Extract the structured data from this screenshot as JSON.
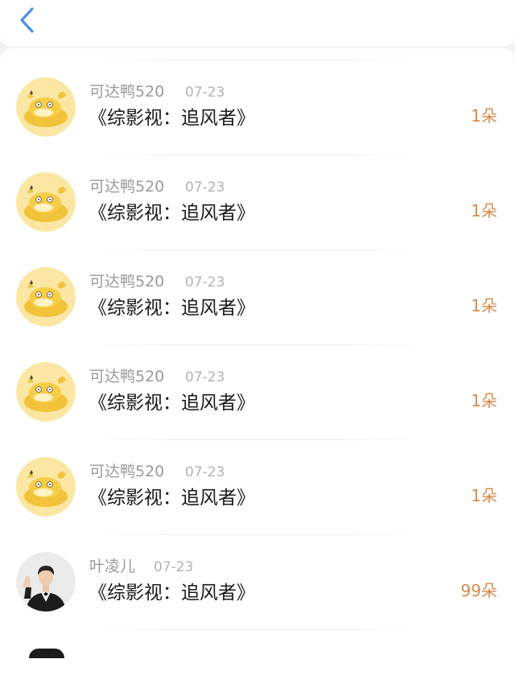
{
  "header": {
    "back_icon": "chevron-left-icon",
    "accent_color": "#4a90e2"
  },
  "gift_list": {
    "amount_color": "#d9894a",
    "items": [
      {
        "name": "可达鸭520",
        "date": "07-23",
        "title": "《综影视：追风者》",
        "amount": "1朵",
        "avatar_icon": "psyduck-avatar-icon"
      },
      {
        "name": "可达鸭520",
        "date": "07-23",
        "title": "《综影视：追风者》",
        "amount": "1朵",
        "avatar_icon": "psyduck-avatar-icon"
      },
      {
        "name": "可达鸭520",
        "date": "07-23",
        "title": "《综影视：追风者》",
        "amount": "1朵",
        "avatar_icon": "psyduck-avatar-icon"
      },
      {
        "name": "可达鸭520",
        "date": "07-23",
        "title": "《综影视：追风者》",
        "amount": "1朵",
        "avatar_icon": "psyduck-avatar-icon"
      },
      {
        "name": "可达鸭520",
        "date": "07-23",
        "title": "《综影视：追风者》",
        "amount": "1朵",
        "avatar_icon": "psyduck-avatar-icon"
      },
      {
        "name": "叶凌儿",
        "date": "07-23",
        "title": "《综影视：追风者》",
        "amount": "99朵",
        "avatar_icon": "person-photo-avatar-icon"
      }
    ]
  }
}
